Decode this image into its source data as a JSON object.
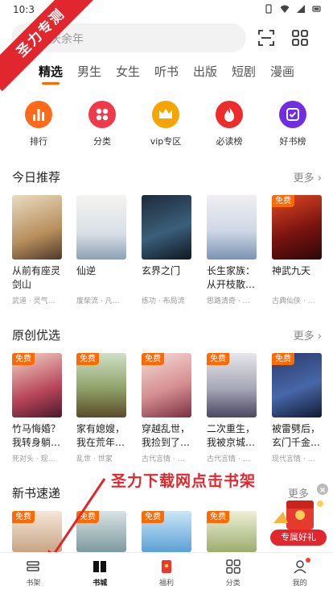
{
  "status_bar": {
    "time": "10:3"
  },
  "watermark": {
    "text": "圣力专测"
  },
  "search": {
    "placeholder": "庆余年"
  },
  "tabs": [
    "精选",
    "男生",
    "女生",
    "听书",
    "出版",
    "短剧",
    "漫画"
  ],
  "shortcuts": [
    {
      "label": "排行",
      "icon": "bar-chart-icon",
      "color": "#ff6a1a"
    },
    {
      "label": "分类",
      "icon": "four-dots-icon",
      "color": "#f1394c"
    },
    {
      "label": "vip专区",
      "icon": "crown-icon",
      "color": "#f6a400"
    },
    {
      "label": "必读榜",
      "icon": "flame-icon",
      "color": "#ee2c2c"
    },
    {
      "label": "好书榜",
      "icon": "check-box-icon",
      "color": "#6f2fe0"
    }
  ],
  "sections": {
    "today": {
      "title": "今日推荐",
      "more": "更多",
      "books": [
        {
          "title": "从前有座灵剑山",
          "meta": "武道 · 灵气…",
          "badge": ""
        },
        {
          "title": "仙逆",
          "meta": "废柴流 · 凡…",
          "badge": ""
        },
        {
          "title": "玄界之门",
          "meta": "练功 · 布局流",
          "badge": ""
        },
        {
          "title": "长生家族：从开枝散…",
          "meta": "思路清奇 · …",
          "badge": ""
        },
        {
          "title": "神武九天",
          "meta": "古典仙侠 · …",
          "badge": "免费"
        }
      ]
    },
    "original": {
      "title": "原创优选",
      "more": "更多",
      "books": [
        {
          "title": "竹马悔婚？我转身躺…",
          "meta": "死对头 · 现…",
          "badge": "免费"
        },
        {
          "title": "家有媳嫂，我在荒年…",
          "meta": "乱世 · 世家",
          "badge": "免费"
        },
        {
          "title": "穿越乱世，我捡到了…",
          "meta": "古代言情 · …",
          "badge": "免费"
        },
        {
          "title": "二次重生，我被京城…",
          "meta": "古代言情 · …",
          "badge": "免费"
        },
        {
          "title": "被雷劈后，玄门千金…",
          "meta": "现代言情 · …",
          "badge": "免费"
        }
      ]
    },
    "new": {
      "title": "新书速递",
      "more": "更多",
      "books": [
        {
          "title": "",
          "meta": "",
          "badge": "免费"
        },
        {
          "title": "",
          "meta": "",
          "badge": "免费"
        },
        {
          "title": "",
          "meta": "",
          "badge": "免费"
        },
        {
          "title": "",
          "meta": "",
          "badge": "免费"
        }
      ]
    }
  },
  "annotation": {
    "text": "圣力下载网点击书架"
  },
  "promo": {
    "label": "专属好礼"
  },
  "bottom_nav": [
    {
      "label": "书架",
      "icon": "bookshelf-icon"
    },
    {
      "label": "书城",
      "icon": "book-icon",
      "active": true
    },
    {
      "label": "福利",
      "icon": "red-packet-icon"
    },
    {
      "label": "分类",
      "icon": "grid-icon"
    },
    {
      "label": "我的",
      "icon": "user-icon"
    }
  ]
}
